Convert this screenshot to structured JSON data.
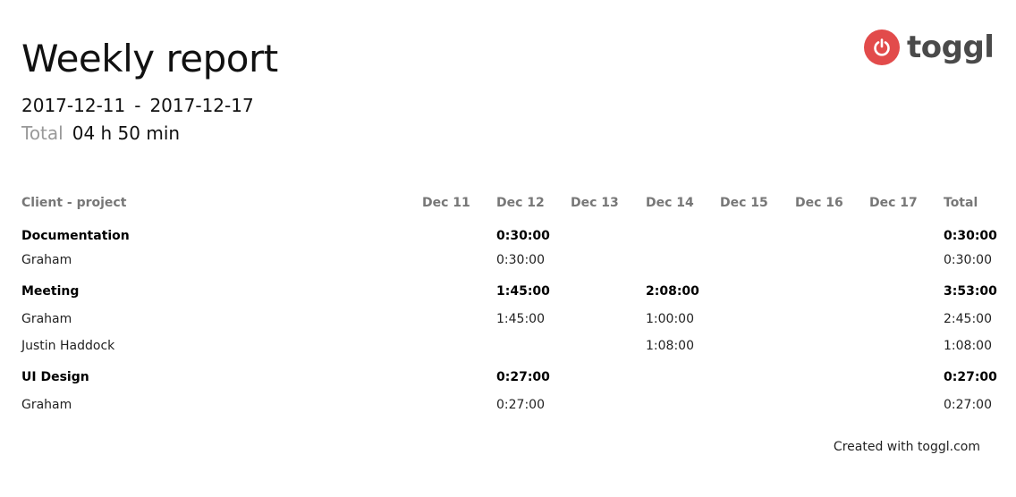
{
  "report": {
    "title": "Weekly report",
    "date_start": "2017-12-11",
    "date_separator": "-",
    "date_end": "2017-12-17",
    "total_label": "Total",
    "total_value": "04 h 50 min"
  },
  "brand": {
    "name": "toggl",
    "icon": "power-icon",
    "accent_color": "#e24b4b"
  },
  "table": {
    "headers": [
      "Client - project",
      "Dec 11",
      "Dec 12",
      "Dec 13",
      "Dec 14",
      "Dec 15",
      "Dec 16",
      "Dec 17",
      "Total"
    ],
    "groups": [
      {
        "name": "Documentation",
        "days": [
          "",
          "0:30:00",
          "",
          "",
          "",
          "",
          ""
        ],
        "total": "0:30:00",
        "items": [
          {
            "name": "Graham",
            "days": [
              "",
              "0:30:00",
              "",
              "",
              "",
              "",
              ""
            ],
            "total": "0:30:00"
          }
        ]
      },
      {
        "name": "Meeting",
        "days": [
          "",
          "1:45:00",
          "",
          "2:08:00",
          "",
          "",
          ""
        ],
        "total": "3:53:00",
        "items": [
          {
            "name": "Graham",
            "days": [
              "",
              "1:45:00",
              "",
              "1:00:00",
              "",
              "",
              ""
            ],
            "total": "2:45:00"
          },
          {
            "name": "Justin Haddock",
            "days": [
              "",
              "",
              "",
              "1:08:00",
              "",
              "",
              ""
            ],
            "total": "1:08:00"
          }
        ]
      },
      {
        "name": "UI Design",
        "days": [
          "",
          "0:27:00",
          "",
          "",
          "",
          "",
          ""
        ],
        "total": "0:27:00",
        "items": [
          {
            "name": "Graham",
            "days": [
              "",
              "0:27:00",
              "",
              "",
              "",
              "",
              ""
            ],
            "total": "0:27:00"
          }
        ]
      }
    ]
  },
  "footer": {
    "text": "Created with toggl.com"
  }
}
